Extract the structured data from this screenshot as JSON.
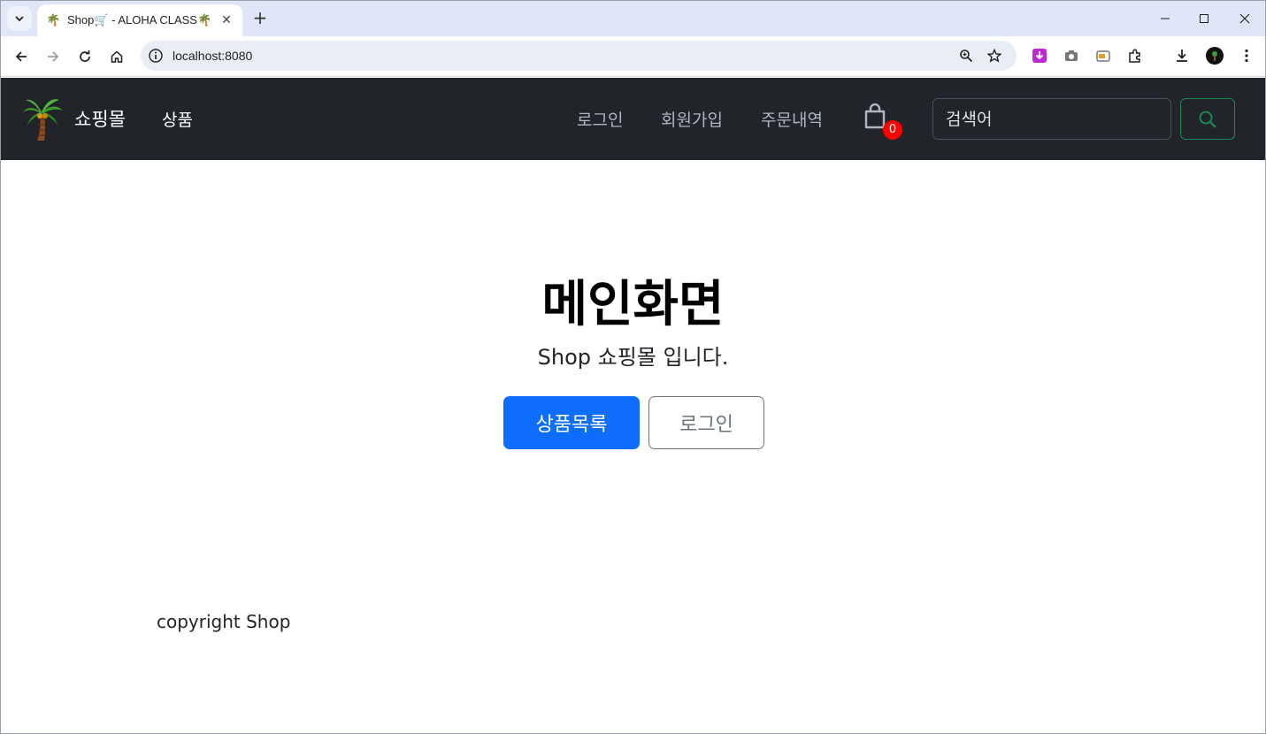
{
  "browser": {
    "tab_title": "Shop🛒 - ALOHA CLASS🌴",
    "tab_favicon": "🌴",
    "url": "localhost:8080"
  },
  "navbar": {
    "brand": "쇼핑몰",
    "products": "상품",
    "links": [
      "로그인",
      "회원가입",
      "주문내역"
    ],
    "cart_count": "0",
    "search_placeholder": "검색어",
    "colors": {
      "bg": "#212529",
      "search_accent": "#198754",
      "badge": "#ff0000"
    }
  },
  "hero": {
    "title": "메인화면",
    "subtitle": "Shop 쇼핑몰 입니다.",
    "primary_button": "상품목록",
    "secondary_button": "로그인",
    "colors": {
      "primary": "#0d6efd",
      "secondary": "#6c757d"
    }
  },
  "footer": {
    "text": "copyright Shop"
  }
}
